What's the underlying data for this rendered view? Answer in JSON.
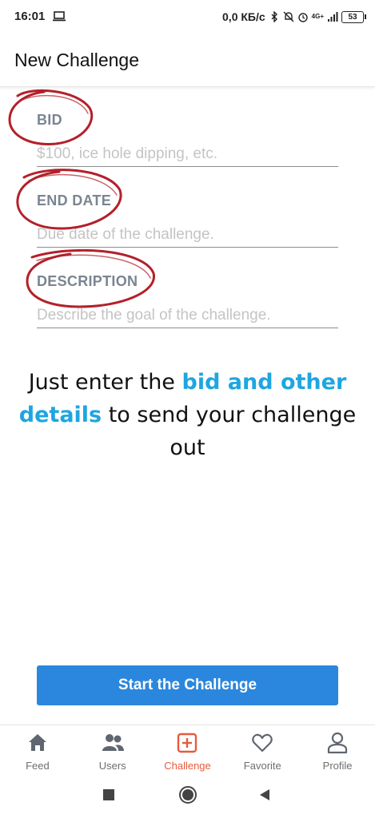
{
  "status_bar": {
    "time": "16:01",
    "network_speed": "0,0 КБ/с",
    "network_type": "4G+",
    "battery": "53"
  },
  "app_bar": {
    "title": "New Challenge"
  },
  "form": {
    "bid": {
      "label": "BID",
      "placeholder": "$100, ice hole dipping, etc."
    },
    "end_date": {
      "label": "END DATE",
      "placeholder": "Due date of the challenge."
    },
    "description": {
      "label": "DESCRIPTION",
      "placeholder": "Describe the goal of the challenge."
    }
  },
  "promo": {
    "text_before": "Just enter the ",
    "highlight_1": "bid and other",
    "highlight_2": "details",
    "text_after": " to send your challenge out",
    "highlight_color": "#1ea6e0"
  },
  "cta": {
    "label": "Start the Challenge",
    "color": "#2b87dd"
  },
  "tab_bar": {
    "active_color": "#e65b3e",
    "items": [
      {
        "label": "Feed",
        "icon": "home-icon"
      },
      {
        "label": "Users",
        "icon": "users-icon"
      },
      {
        "label": "Challenge",
        "icon": "plus-square-icon"
      },
      {
        "label": "Favorite",
        "icon": "heart-icon"
      },
      {
        "label": "Profile",
        "icon": "user-icon"
      }
    ]
  },
  "annotation": {
    "circle_color": "#b3202a"
  }
}
